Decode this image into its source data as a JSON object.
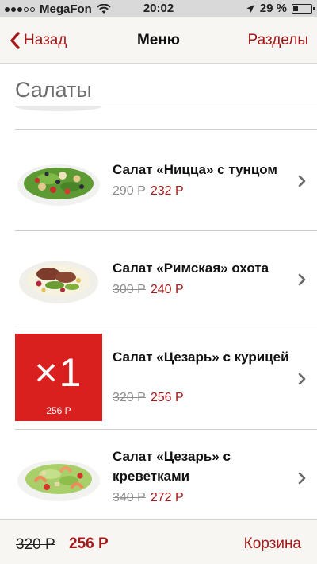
{
  "status_bar": {
    "carrier": "MegaFon",
    "time": "20:02",
    "battery_percent": 29,
    "battery_label": "29 %"
  },
  "nav": {
    "back_label": "Назад",
    "title": "Меню",
    "right_label": "Разделы"
  },
  "section": {
    "title": "Салаты"
  },
  "items": [
    {
      "name": "Салат «Ницца» с тунцом",
      "old_price": "290 Р",
      "new_price": "232 Р"
    },
    {
      "name": "Салат «Римская» охота",
      "old_price": "300 Р",
      "new_price": "240 Р"
    },
    {
      "name": "Салат «Цезарь» с курицей",
      "old_price": "320 Р",
      "new_price": "256 Р",
      "quantity": "×1",
      "quantity_price": "256 Р"
    },
    {
      "name": "Салат «Цезарь» с креветками",
      "old_price": "340 Р",
      "new_price": "272 Р"
    }
  ],
  "bottom": {
    "old_total": "320 Р",
    "new_total": "256 Р",
    "cart_label": "Корзина"
  },
  "colors": {
    "accent": "#a41a1a",
    "selected_tile": "#d9201f",
    "old_price": "#8e8e8e"
  }
}
